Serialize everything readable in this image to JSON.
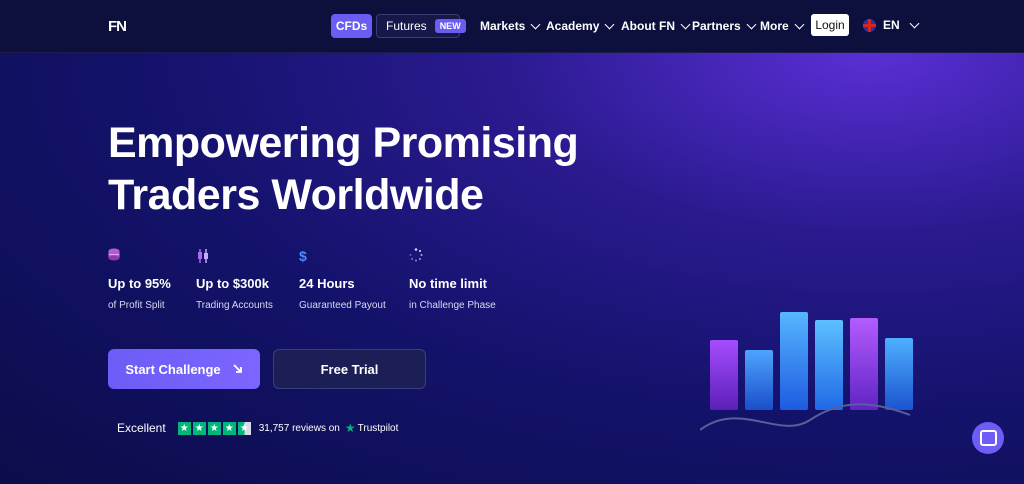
{
  "header": {
    "logo": "FN",
    "cfds": "CFDs",
    "futures": "Futures",
    "new_badge": "NEW",
    "nav": [
      "Markets",
      "Academy",
      "About FN",
      "Partners",
      "More"
    ],
    "login": "Login",
    "lang": "EN"
  },
  "hero": {
    "title_line1": "Empowering Promising",
    "title_line2": "Traders Worldwide",
    "features": [
      {
        "icon": "coins-icon",
        "big": "Up to 95%",
        "small": "of Profit Split"
      },
      {
        "icon": "candlestick-icon",
        "big": "Up to $300k",
        "small": "Trading Accounts"
      },
      {
        "icon": "dollar-icon",
        "big": "24 Hours",
        "small": "Guaranteed Payout"
      },
      {
        "icon": "loader-icon",
        "big": "No time limit",
        "small": "in Challenge Phase"
      }
    ],
    "start_btn": "Start Challenge",
    "trial_btn": "Free Trial"
  },
  "trustpilot": {
    "rating_word": "Excellent",
    "reviews": "31,757 reviews on",
    "brand": "Trustpilot",
    "stars": 4.5
  },
  "colors": {
    "accent": "#6d5cf6",
    "trustpilot": "#00b67a",
    "bg": "#13126a"
  }
}
